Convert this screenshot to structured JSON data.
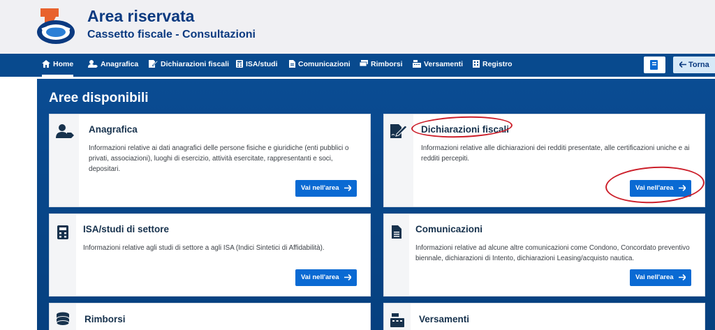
{
  "header": {
    "title": "Area riservata",
    "subtitle": "Cassetto fiscale - Consultazioni"
  },
  "nav": {
    "items": [
      {
        "label": "Home",
        "icon": "home-icon"
      },
      {
        "label": "Anagrafica",
        "icon": "user-tag-icon"
      },
      {
        "label": "Dichiarazioni fiscali",
        "icon": "file-signature-icon"
      },
      {
        "label": "ISA/studi",
        "icon": "calculator-icon"
      },
      {
        "label": "Comunicazioni",
        "icon": "file-alt-icon"
      },
      {
        "label": "Rimborsi",
        "icon": "money-bills-icon"
      },
      {
        "label": "Versamenti",
        "icon": "cash-register-icon"
      },
      {
        "label": "Registro",
        "icon": "building-icon"
      }
    ],
    "active": "Home",
    "book_icon": "book-icon",
    "back_label": "Torna"
  },
  "main": {
    "section_title": "Aree disponibili",
    "cards": [
      {
        "title": "Anagrafica",
        "description": "Informazioni relative ai dati anagrafici delle persone fisiche e giuridiche (enti pubblici o privati, associazioni), luoghi di esercizio, attività esercitate, rappresentanti e soci, depositari.",
        "button": "Vai nell'area",
        "icon": "user-tag-icon"
      },
      {
        "title": "Dichiarazioni fiscali",
        "description": "Informazioni relative alle dichiarazioni dei redditi presentate, alle certificazioni uniche e ai redditi percepiti.",
        "button": "Vai nell'area",
        "icon": "file-signature-icon"
      },
      {
        "title": "ISA/studi di settore",
        "description": "Informazioni relative agli studi di settore a agli ISA (Indici Sintetici di Affidabilità).",
        "button": "Vai nell'area",
        "icon": "calculator-icon"
      },
      {
        "title": "Comunicazioni",
        "description": "Informazioni relative ad alcune altre comunicazioni come Condono, Concordato preventivo biennale, dichiarazioni di Intento, dichiarazioni Leasing/acquisto nautica.",
        "button": "Vai nell'area",
        "icon": "file-alt-icon"
      },
      {
        "title": "Rimborsi",
        "icon": "coins-icon"
      },
      {
        "title": "Versamenti",
        "icon": "cash-register-icon"
      }
    ]
  },
  "colors": {
    "nav_bg": "#084a8e",
    "brand_text": "#0b3a80",
    "button_bg": "#0a6ad3",
    "annotation_red": "#cc1f2a"
  }
}
